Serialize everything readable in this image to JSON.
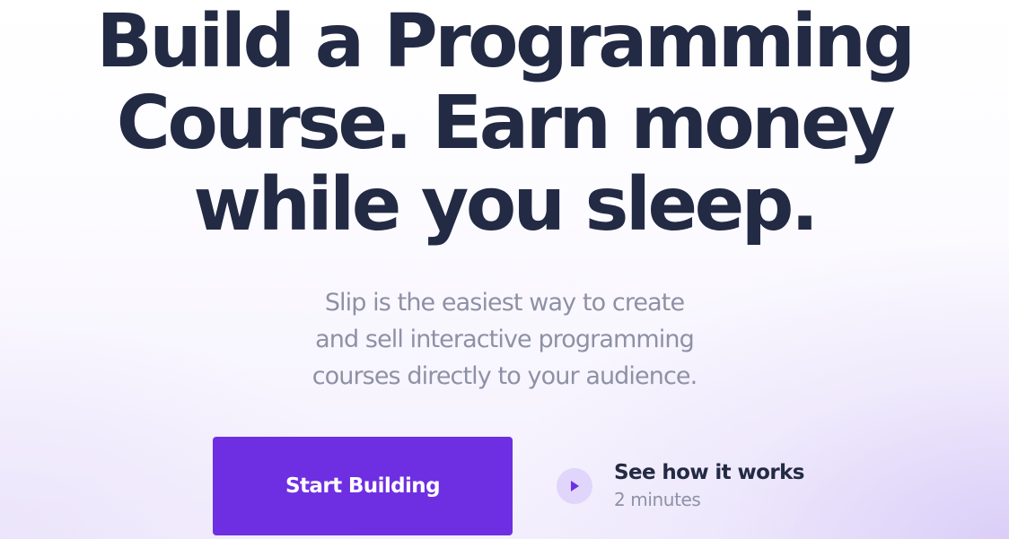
{
  "hero": {
    "headline_lines": [
      "Build a Programming",
      "Course. Earn money",
      "while you sleep."
    ],
    "subtitle_lines": [
      "Slip is the easiest way to create",
      "and sell interactive programming",
      "courses directly to your audience."
    ]
  },
  "cta": {
    "primary_label": "Start Building"
  },
  "video": {
    "title": "See how it works",
    "duration": "2 minutes",
    "icon": "play-icon"
  },
  "colors": {
    "headline": "#232a44",
    "subtitle": "#8e91a5",
    "accent": "#6e2fe2",
    "play_circle": "#e0d5fb"
  }
}
